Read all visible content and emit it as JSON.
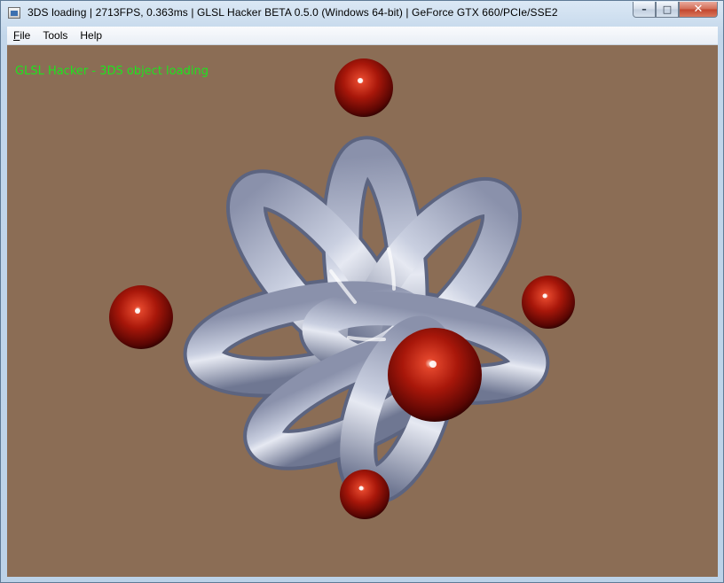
{
  "window": {
    "title": "3DS loading | 2713FPS, 0.363ms | GLSL Hacker BETA 0.5.0 (Windows 64-bit) | GeForce GTX 660/PCIe/SSE2",
    "caption_buttons": {
      "minimize": "–",
      "maximize": "□",
      "close": "✕"
    }
  },
  "menu": {
    "items": [
      {
        "accel": "F",
        "rest": "ile"
      },
      {
        "accel": "",
        "rest": "Tools"
      },
      {
        "accel": "",
        "rest": "Help"
      }
    ]
  },
  "viewport": {
    "overlay_text": "GLSL Hacker - 3DS object loading",
    "background_color": "#8b6d55",
    "overlay_color": "#1fe31f",
    "torus_color": "#aab3c9",
    "sphere_color": "#b01a0c"
  }
}
